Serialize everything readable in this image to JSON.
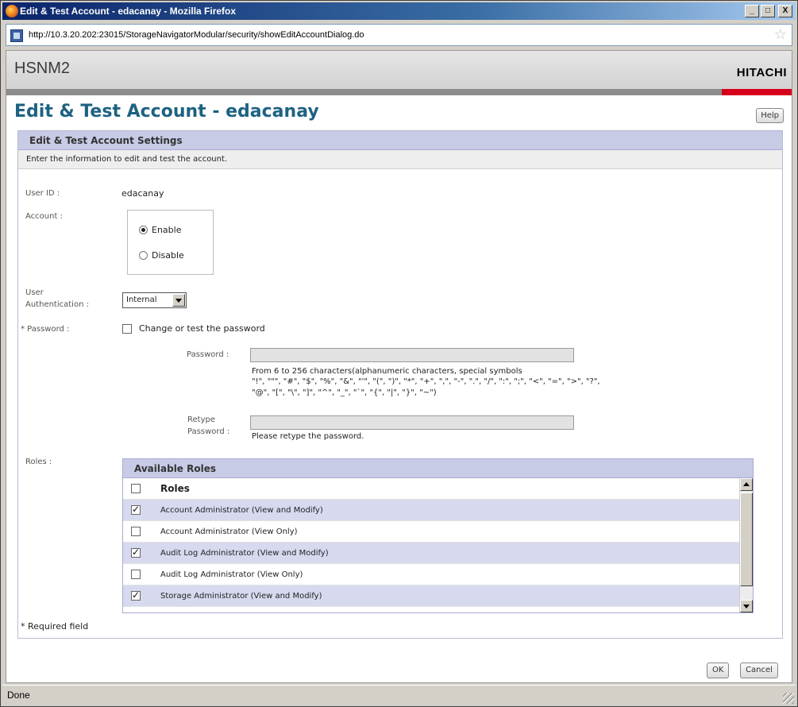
{
  "window": {
    "title": "Edit & Test Account - edacanay - Mozilla Firefox",
    "buttons": {
      "minimize": "_",
      "maximize": "□",
      "close": "X"
    }
  },
  "browser": {
    "url": "http://10.3.20.202:23015/StorageNavigatorModular/security/showEditAccountDialog.do",
    "star_icon": "☆",
    "status": "Done"
  },
  "header": {
    "brand": "HSNM2",
    "logo": "HITACHI",
    "accent_color": "#d7001c"
  },
  "page": {
    "title": "Edit & Test Account - edacanay",
    "help_label": "Help"
  },
  "panel": {
    "heading": "Edit & Test Account Settings",
    "description": "Enter the information to edit and test the account."
  },
  "form": {
    "user_id_label": "User ID :",
    "user_id_value": "edacanay",
    "account_label": "Account :",
    "enable_label": "Enable",
    "disable_label": "Disable",
    "account_selected": "Enable",
    "auth_label_1": "User",
    "auth_label_2": "Authentication :",
    "auth_value": "Internal",
    "password_section_label": "* Password :",
    "change_password_label": "Change or test the password",
    "password_label": "Password :",
    "password_value": "",
    "password_hint_1": "From 6 to 256 characters(alphanumeric characters, special symbols",
    "password_hint_2": "\"!\", \"\"\", \"#\", \"$\", \"%\", \"&\", \"'\", \"(\", \")\", \"*\", \"+\", \",\", \"-\", \".\", \"/\", \":\", \";\", \"<\", \"=\", \">\", \"?\",",
    "password_hint_3": "\"@\", \"[\", \"\\\", \"]\", \"^\", \"_\", \"`\", \"{\", \"|\", \"}\", \"~\")",
    "retype_label_1": "Retype",
    "retype_label_2": "Password :",
    "retype_value": "",
    "retype_hint": "Please retype the password.",
    "roles_label": "Roles :",
    "required_note": "* Required field"
  },
  "roles": {
    "heading": "Available Roles",
    "column_header": "Roles",
    "select_all_checked": false,
    "items": [
      {
        "label": "Account Administrator (View and Modify)",
        "checked": true
      },
      {
        "label": "Account Administrator (View Only)",
        "checked": false
      },
      {
        "label": "Audit Log Administrator (View and Modify)",
        "checked": true
      },
      {
        "label": "Audit Log Administrator (View Only)",
        "checked": false
      },
      {
        "label": "Storage Administrator (View and Modify)",
        "checked": true
      }
    ]
  },
  "actions": {
    "ok_label": "OK",
    "cancel_label": "Cancel"
  }
}
